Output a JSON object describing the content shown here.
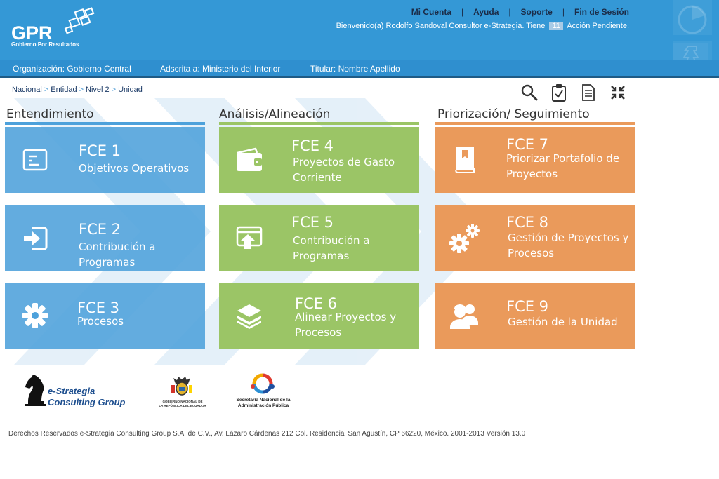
{
  "header": {
    "logo_text": "GPR",
    "logo_subtitle": "Gobierno Por Resultados",
    "nav": [
      "Mi Cuenta",
      "Ayuda",
      "Soporte",
      "Fin de Sesión"
    ],
    "welcome_prefix": "Bienvenido(a) Rodolfo Sandoval Consultor e-Strategia.  Tiene",
    "pending_count": "11",
    "welcome_suffix": "Acción Pendiente."
  },
  "orgbar": {
    "organizacion": "Organización: Gobierno Central",
    "adscrita": "Adscrita a: Ministerio del Interior",
    "titular": "Titular: Nombre Apellido"
  },
  "breadcrumb": [
    "Nacional",
    "Entidad",
    "Nivel 2",
    "Unidad"
  ],
  "tools": [
    "search-icon",
    "clipboard-check-icon",
    "document-icon",
    "compress-icon"
  ],
  "columns": [
    {
      "title": "Entendimiento",
      "color": "#4da1db",
      "tiles": [
        {
          "code": "FCE 1",
          "label": "Objetivos  Operativos",
          "icon": "list-window-icon"
        },
        {
          "code": "FCE 2",
          "label": "Contribución a Programas",
          "icon": "sign-in-icon"
        },
        {
          "code": "FCE 3",
          "label": "Procesos",
          "icon": "gear-icon"
        }
      ]
    },
    {
      "title": "Análisis/Alineación",
      "color": "#9bc566",
      "tiles": [
        {
          "code": "FCE 4",
          "label": "Proyectos de Gasto Corriente",
          "icon": "wallet-icon"
        },
        {
          "code": "FCE 5",
          "label": "Contribución a Programas",
          "icon": "upload-window-icon"
        },
        {
          "code": "FCE 6",
          "label": "Alinear Proyectos y Procesos",
          "icon": "stack-icon"
        }
      ]
    },
    {
      "title": "Priorización/ Seguimiento",
      "color": "#ea9a5b",
      "tiles": [
        {
          "code": "FCE 7",
          "label": "Priorizar Portafolio de Proyectos",
          "icon": "book-icon"
        },
        {
          "code": "FCE 8",
          "label": "Gestión de Proyectos y Procesos",
          "icon": "gears-icon"
        },
        {
          "code": "FCE 9",
          "label": "Gestión de la Unidad",
          "icon": "team-icon"
        }
      ]
    }
  ],
  "footer": {
    "logo1_line1": "e-Strategia",
    "logo1_line2": "Consulting Group",
    "logo2_line1": "GOBIERNO NACIONAL DE",
    "logo2_line2": "LA REPÚBLICA DEL ECUADOR",
    "logo3_line1": "Secretaría Nacional de la",
    "logo3_line2": "Administración Pública",
    "copyright": "Derechos Reservados e-Strategia Consulting Group S.A. de C.V., Av. Lázaro Cárdenas 212 Col. Residencial San Agustín, CP 66220, México. 2001-2013 Versión 13.0"
  }
}
